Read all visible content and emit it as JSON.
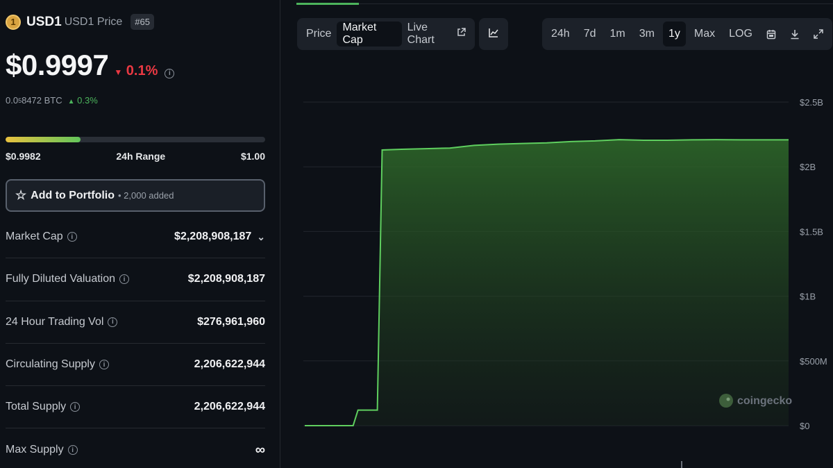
{
  "coin": {
    "logo_char": "1",
    "symbol": "USD1",
    "name": "USD1 Price",
    "rank": "#65"
  },
  "price": {
    "value": "$0.9997",
    "change": "0.1%",
    "change_dir": "down"
  },
  "btc": {
    "prefix": "0.0",
    "sub": "5",
    "rest": "8472 BTC",
    "change": "0.3%"
  },
  "range": {
    "low": "$0.9982",
    "label": "24h Range",
    "high": "$1.00",
    "fill_fraction": 0.29
  },
  "portfolio": {
    "label": "Add to Portfolio",
    "added": "• 2,000 added"
  },
  "stats": [
    {
      "label": "Market Cap",
      "value": "$2,208,908,187",
      "expand": true
    },
    {
      "label": "Fully Diluted Valuation",
      "value": "$2,208,908,187"
    },
    {
      "label": "24 Hour Trading Vol",
      "value": "$276,961,960"
    },
    {
      "label": "Circulating Supply",
      "value": "2,206,622,944"
    },
    {
      "label": "Total Supply",
      "value": "2,206,622,944"
    },
    {
      "label": "Max Supply",
      "value": "∞"
    }
  ],
  "chart_tabs": {
    "price": "Price",
    "market_cap": "Market Cap",
    "live_chart": "Live Chart",
    "active": "market_cap"
  },
  "timeframes": {
    "t24h": "24h",
    "t7d": "7d",
    "t1m": "1m",
    "t3m": "3m",
    "t1y": "1y",
    "tmax": "Max",
    "log": "LOG",
    "active": "1y"
  },
  "colors": {
    "up": "#4cb45c",
    "down": "#ea3943",
    "line": "#5fcf5f",
    "bg": "#0d1117"
  },
  "chart_data": {
    "type": "area",
    "title": "",
    "xlabel": "",
    "ylabel": "",
    "ylim": [
      0,
      2500000000
    ],
    "yticks": [
      "$2.5B",
      "$2B",
      "$1.5B",
      "$1B",
      "$500M",
      "$0"
    ],
    "watermark": "coingecko",
    "x": [
      0,
      10,
      11,
      15,
      16,
      20,
      25,
      30,
      35,
      40,
      45,
      50,
      55,
      60,
      65,
      70,
      75,
      80,
      85,
      90,
      95,
      100
    ],
    "values": [
      0,
      0,
      120000000,
      120000000,
      2130000000,
      2135000000,
      2140000000,
      2145000000,
      2165000000,
      2175000000,
      2180000000,
      2185000000,
      2195000000,
      2200000000,
      2210000000,
      2205000000,
      2205000000,
      2208000000,
      2210000000,
      2208000000,
      2208000000,
      2208000000
    ],
    "grid": true
  }
}
